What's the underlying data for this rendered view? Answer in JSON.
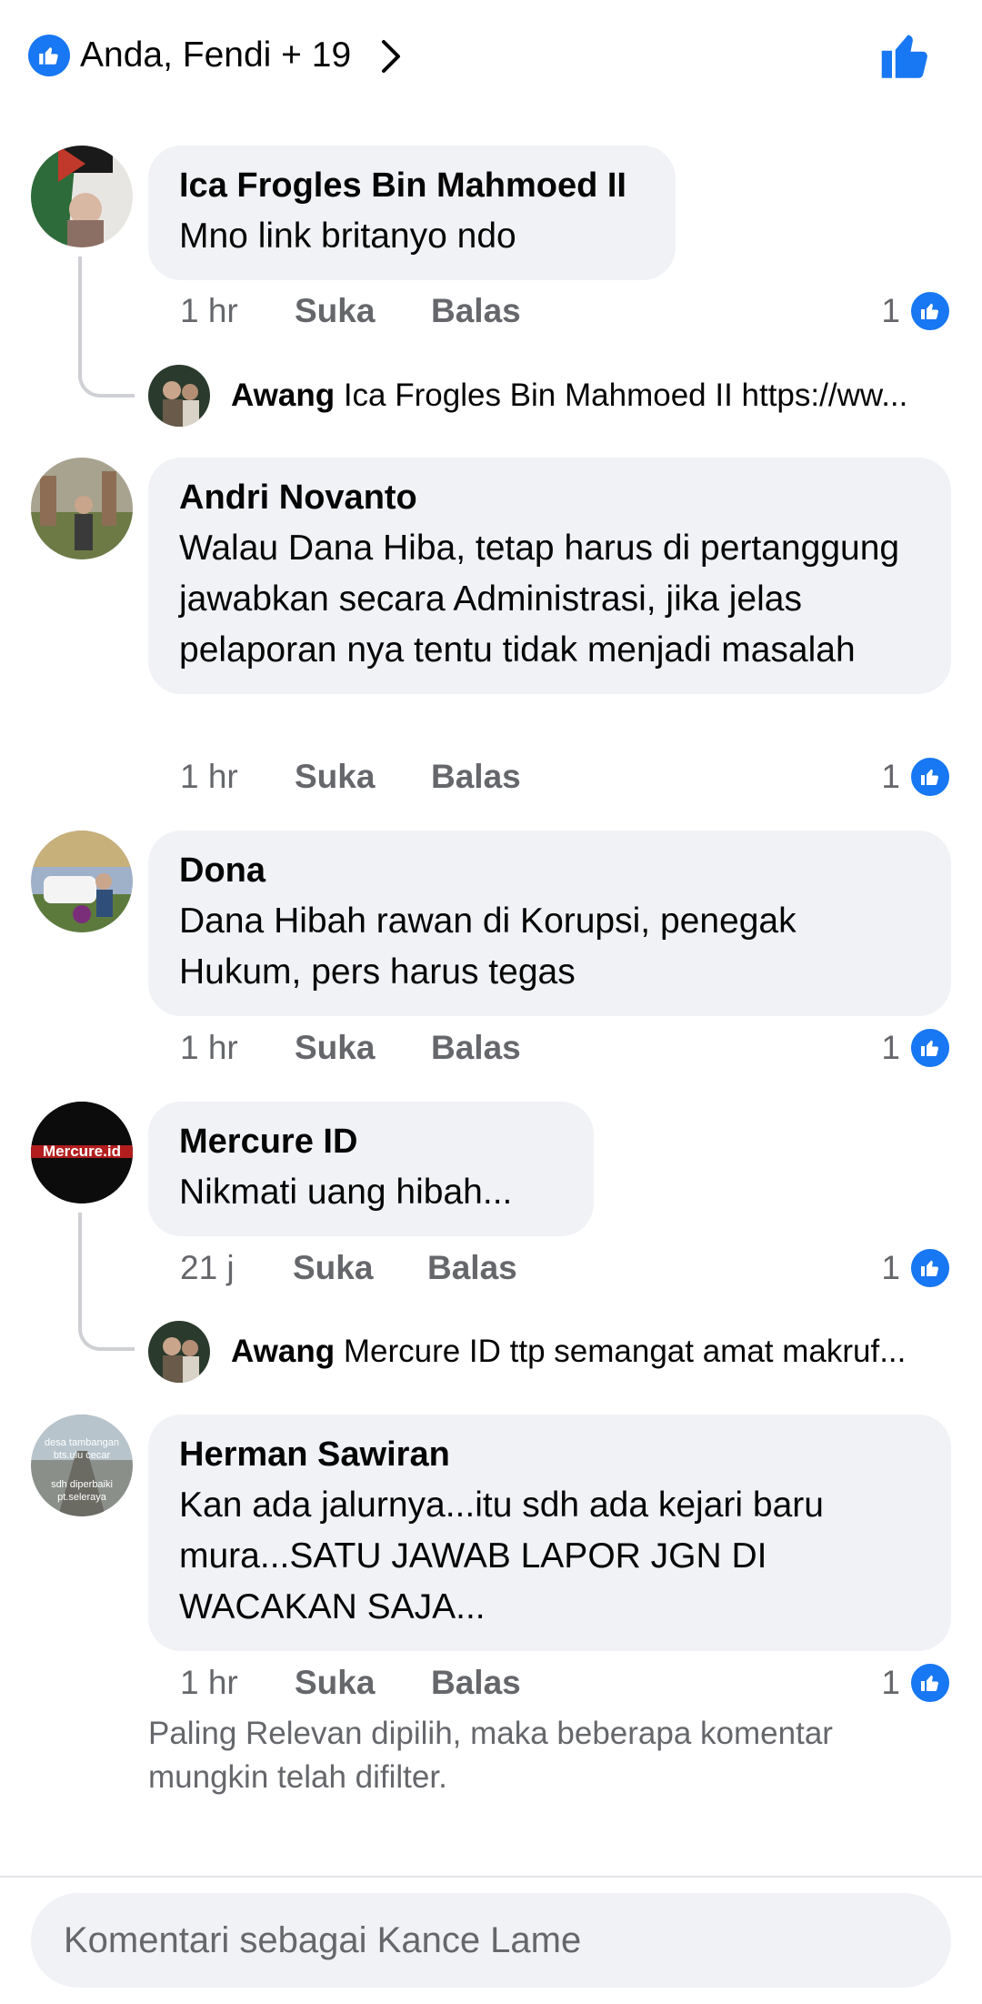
{
  "header": {
    "reactors": "Anda, Fendi + 19"
  },
  "comments": [
    {
      "name": "Ica Frogles Bin Mahmoed II",
      "text": "Mno link britanyo ndo",
      "time": "1 hr",
      "like": "Suka",
      "reply": "Balas",
      "likes": "1",
      "reply_preview": {
        "name": "Awang",
        "text": "Ica Frogles Bin Mahmoed II https://ww..."
      }
    },
    {
      "name": "Andri Novanto",
      "text": "Walau Dana Hiba, tetap harus di pertanggung jawabkan secara Administrasi, jika jelas pelaporan nya tentu tidak menjadi masalah",
      "time": "1 hr",
      "like": "Suka",
      "reply": "Balas",
      "likes": "1"
    },
    {
      "name": "Dona",
      "text": "Dana Hibah rawan di Korupsi,  penegak Hukum,  pers harus tegas",
      "time": "1 hr",
      "like": "Suka",
      "reply": "Balas",
      "likes": "1"
    },
    {
      "name": "Mercure ID",
      "text": "Nikmati uang hibah...",
      "time": "21 j",
      "like": "Suka",
      "reply": "Balas",
      "likes": "1",
      "avatar_text": "Mercure.id",
      "reply_preview": {
        "name": "Awang",
        "text": "Mercure ID ttp semangat amat makruf..."
      }
    },
    {
      "name": "Herman Sawiran",
      "text": "Kan ada jalurnya...itu sdh ada kejari baru mura...SATU JAWAB LAPOR JGN DI WACAKAN SAJA...",
      "time": "1 hr",
      "like": "Suka",
      "reply": "Balas",
      "likes": "1",
      "avatar_text": [
        "desa tambangan",
        "bts.ulu cecar",
        "sdh diperbaiki",
        "pt.seleraya"
      ]
    }
  ],
  "footer_note": "Paling Relevan dipilih, maka beberapa komentar mungkin telah difilter.",
  "composer": {
    "placeholder": "Komentari sebagai Kance Lame"
  },
  "colors": {
    "accent": "#1877f2",
    "bubble": "#f0f2f5",
    "secondary_text": "#65676b"
  }
}
